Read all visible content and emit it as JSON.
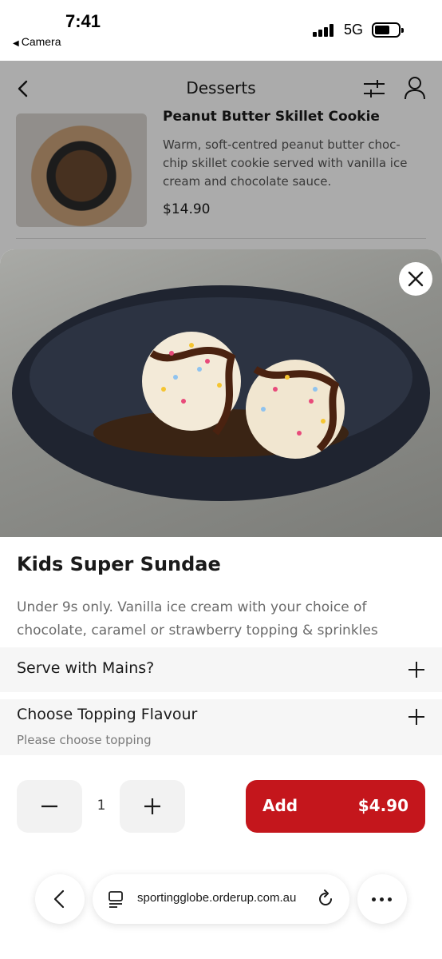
{
  "status_bar": {
    "time": "7:41",
    "back_app": "Camera",
    "network": "5G"
  },
  "header": {
    "title": "Desserts",
    "icons": [
      "chevron-left-icon",
      "filter-sliders-icon",
      "user-icon"
    ]
  },
  "underlying_item": {
    "name": "Peanut Butter Skillet Cookie",
    "description": "Warm, soft-centred peanut butter choc-chip skillet cookie served with vanilla ice cream and chocolate sauce.",
    "price": "$14.90"
  },
  "modal": {
    "title": "Kids Super Sundae",
    "description": "Under 9s only. Vanilla ice cream with your choice of chocolate, caramel or strawberry topping & sprinkles",
    "options": [
      {
        "title": "Serve with Mains?",
        "subtitle": ""
      },
      {
        "title": "Choose Topping Flavour",
        "subtitle": "Please choose topping"
      }
    ],
    "quantity": "1",
    "add_label": "Add",
    "add_price": "$4.90"
  },
  "browser": {
    "url": "sportingglobe.orderup.com.au"
  },
  "colors": {
    "accent": "#c4161c",
    "option_bg": "#f6f6f6"
  }
}
